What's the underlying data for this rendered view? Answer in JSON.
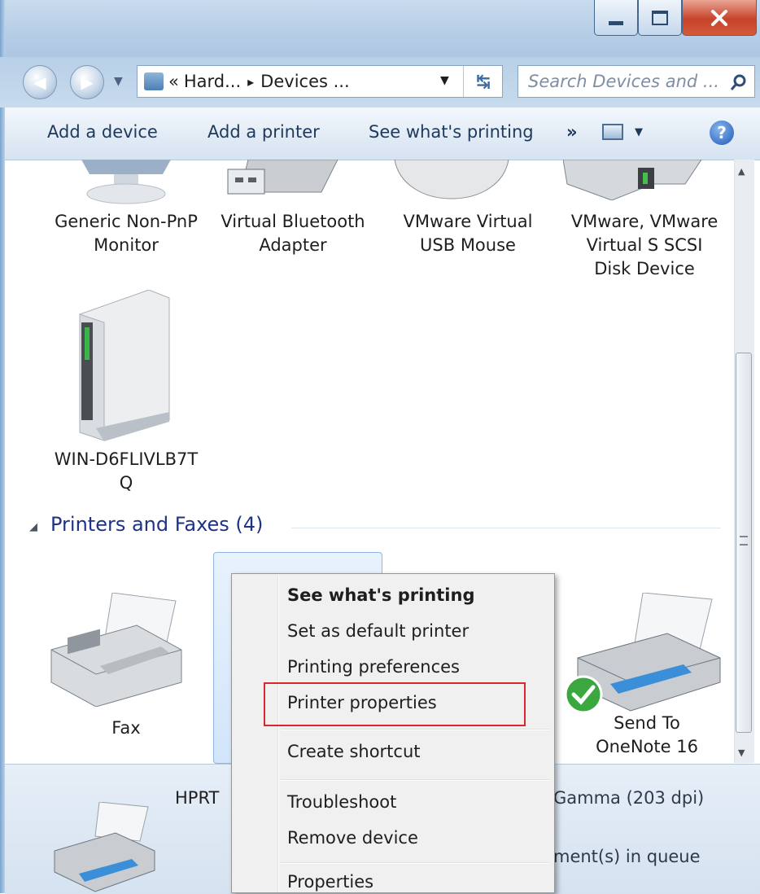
{
  "window": {
    "caption_buttons": {
      "minimize": "minimize-icon",
      "maximize": "maximize-icon",
      "close": "close-icon"
    }
  },
  "nav": {
    "breadcrumb": {
      "prefix": "«",
      "first": "Hard...",
      "separator": "▸",
      "second": "Devices ..."
    },
    "search_placeholder": "Search Devices and ..."
  },
  "toolbar": {
    "add_device": "Add a device",
    "add_printer": "Add a printer",
    "see_printing": "See what's printing",
    "overflow": "»"
  },
  "devices": [
    {
      "label": "Generic Non-PnP\nMonitor",
      "icon": "monitor-icon"
    },
    {
      "label": "Virtual Bluetooth\nAdapter",
      "icon": "usb-adapter-icon"
    },
    {
      "label": "VMware Virtual\nUSB Mouse",
      "icon": "mouse-icon"
    },
    {
      "label": "VMware, VMware\nVirtual S SCSI\nDisk Device",
      "icon": "disk-icon"
    },
    {
      "label": "WIN-D6FLIVLB7T\nQ",
      "icon": "computer-tower-icon"
    }
  ],
  "printers_section": {
    "title": "Printers and Faxes (4)"
  },
  "printers": [
    {
      "label": "Fax",
      "icon": "fax-icon"
    },
    {
      "label": "Send To\nOneNote 16",
      "icon": "printer-icon"
    }
  ],
  "details": {
    "name_partial": "HPRT",
    "model_partial": "Gamma (203 dpi)",
    "queue_partial": "ment(s) in queue"
  },
  "context_menu": {
    "items": [
      "See what's printing",
      "Set as default printer",
      "Printing preferences",
      "Printer properties",
      "Create shortcut",
      "Troubleshoot",
      "Remove device",
      "Properties"
    ],
    "highlight_color": "#d9262f"
  },
  "colors": {
    "section_title": "#1e3287",
    "toolbar_text": "#1e395b"
  }
}
